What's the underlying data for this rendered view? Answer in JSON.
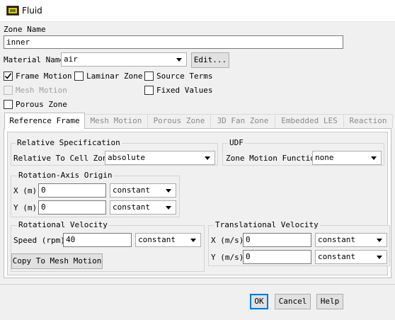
{
  "window": {
    "title": "Fluid"
  },
  "zone": {
    "label": "Zone Name",
    "value": "inner"
  },
  "material": {
    "label": "Material Name",
    "value": "air",
    "edit_button": "Edit..."
  },
  "options": {
    "frame_motion": {
      "label": "Frame Motion",
      "checked": true
    },
    "laminar_zone": {
      "label": "Laminar Zone",
      "checked": false
    },
    "source_terms": {
      "label": "Source Terms",
      "checked": false
    },
    "mesh_motion": {
      "label": "Mesh Motion",
      "checked": false,
      "enabled": false
    },
    "fixed_values": {
      "label": "Fixed Values",
      "checked": false
    },
    "porous_zone": {
      "label": "Porous Zone",
      "checked": false
    }
  },
  "tabs": [
    {
      "label": "Reference Frame",
      "active": true
    },
    {
      "label": "Mesh Motion"
    },
    {
      "label": "Porous Zone"
    },
    {
      "label": "3D Fan Zone"
    },
    {
      "label": "Embedded LES"
    },
    {
      "label": "Reaction"
    }
  ],
  "relative_spec": {
    "title": "Relative Specification",
    "label": "Relative To Cell Zone",
    "value": "absolute"
  },
  "udf": {
    "title": "UDF",
    "label": "Zone Motion Function",
    "value": "none"
  },
  "rotation_axis_origin": {
    "title": "Rotation-Axis Origin",
    "x": {
      "label": "X (m)",
      "value": "0",
      "method": "constant"
    },
    "y": {
      "label": "Y (m)",
      "value": "0",
      "method": "constant"
    }
  },
  "rotational_velocity": {
    "title": "Rotational Velocity",
    "speed": {
      "label": "Speed (rpm)",
      "value": "40",
      "method": "constant"
    }
  },
  "copy_button": "Copy To Mesh Motion",
  "translational_velocity": {
    "title": "Translational Velocity",
    "x": {
      "label": "X (m/s)",
      "value": "0",
      "method": "constant"
    },
    "y": {
      "label": "Y (m/s)",
      "value": "0",
      "method": "constant"
    }
  },
  "footer": {
    "ok": "OK",
    "cancel": "Cancel",
    "help": "Help"
  }
}
